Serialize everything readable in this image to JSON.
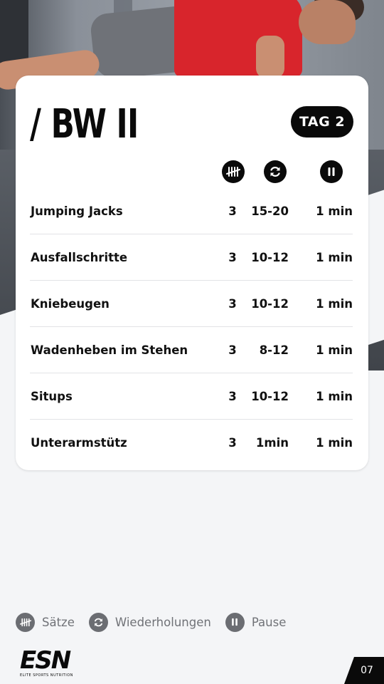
{
  "card": {
    "title": "/ BW II",
    "day_badge": "TAG 2",
    "columns": [
      {
        "key": "sets",
        "icon": "tally-icon"
      },
      {
        "key": "reps",
        "icon": "repeat-icon"
      },
      {
        "key": "pause",
        "icon": "pause-icon"
      }
    ],
    "exercises": [
      {
        "name": "Jumping Jacks",
        "sets": "3",
        "reps": "15-20",
        "pause": "1 min"
      },
      {
        "name": "Ausfallschritte",
        "sets": "3",
        "reps": "10-12",
        "pause": "1 min"
      },
      {
        "name": "Kniebeugen",
        "sets": "3",
        "reps": "10-12",
        "pause": "1 min"
      },
      {
        "name": "Wadenheben im Stehen",
        "sets": "3",
        "reps": "8-12",
        "pause": "1 min"
      },
      {
        "name": "Situps",
        "sets": "3",
        "reps": "10-12",
        "pause": "1 min"
      },
      {
        "name": "Unterarmstütz",
        "sets": "3",
        "reps": "1min",
        "pause": "1 min"
      }
    ]
  },
  "legend": {
    "sets_label": "Sätze",
    "reps_label": "Wiederholungen",
    "pause_label": "Pause"
  },
  "footer": {
    "logo_mark": "ESN",
    "logo_sub": "ELITE SPORTS NUTRITION",
    "page_number": "07"
  },
  "colors": {
    "badge_bg": "#0a0a0a",
    "legend_icon": "#6b6d72",
    "shirt_red": "#d8252c"
  }
}
